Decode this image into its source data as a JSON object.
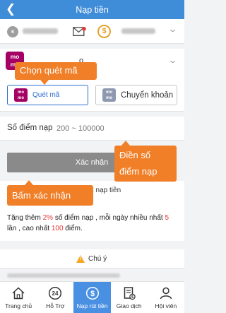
{
  "header": {
    "title": "Nạp tiền",
    "back_icon": "chevron-left-icon"
  },
  "user": {
    "avatar_letter": "s",
    "balance_icon": "coin-icon"
  },
  "payment_method": {
    "selected_suffix": "o"
  },
  "tabs": [
    {
      "label": "Quét mã",
      "icon_text": "mo mo"
    },
    {
      "label": "Chuyển khoản",
      "icon_text": "mo mo"
    }
  ],
  "amount": {
    "label": "Số điểm nạp",
    "placeholder": "200 ~ 100000"
  },
  "confirm_button": "Xác nhận",
  "promo": {
    "heading": "ãi nạp tiền",
    "text_parts": [
      "Tặng thêm ",
      "2%",
      " số điểm nạp , mỗi ngày nhiều nhất ",
      "5",
      " lần , cao nhất ",
      "100",
      " điểm."
    ]
  },
  "note": {
    "label": "Chú ý"
  },
  "annotations": {
    "scan": "Chọn quét mã",
    "enter_amount": "Điền số điểm nạp",
    "press_confirm": "Bấm xác nhận"
  },
  "nav": [
    {
      "label": "Trang chủ",
      "icon": "home-icon"
    },
    {
      "label": "Hỗ Trợ",
      "icon": "support-24-icon"
    },
    {
      "label": "Nạp rút tiền",
      "icon": "deposit-icon"
    },
    {
      "label": "Giao dịch",
      "icon": "transactions-icon"
    },
    {
      "label": "Hội viên",
      "icon": "member-icon"
    }
  ],
  "colors": {
    "header": "#3f8cd8",
    "accent": "#f07f28",
    "momo": "#a50064",
    "active_nav": "#4a90e2"
  }
}
